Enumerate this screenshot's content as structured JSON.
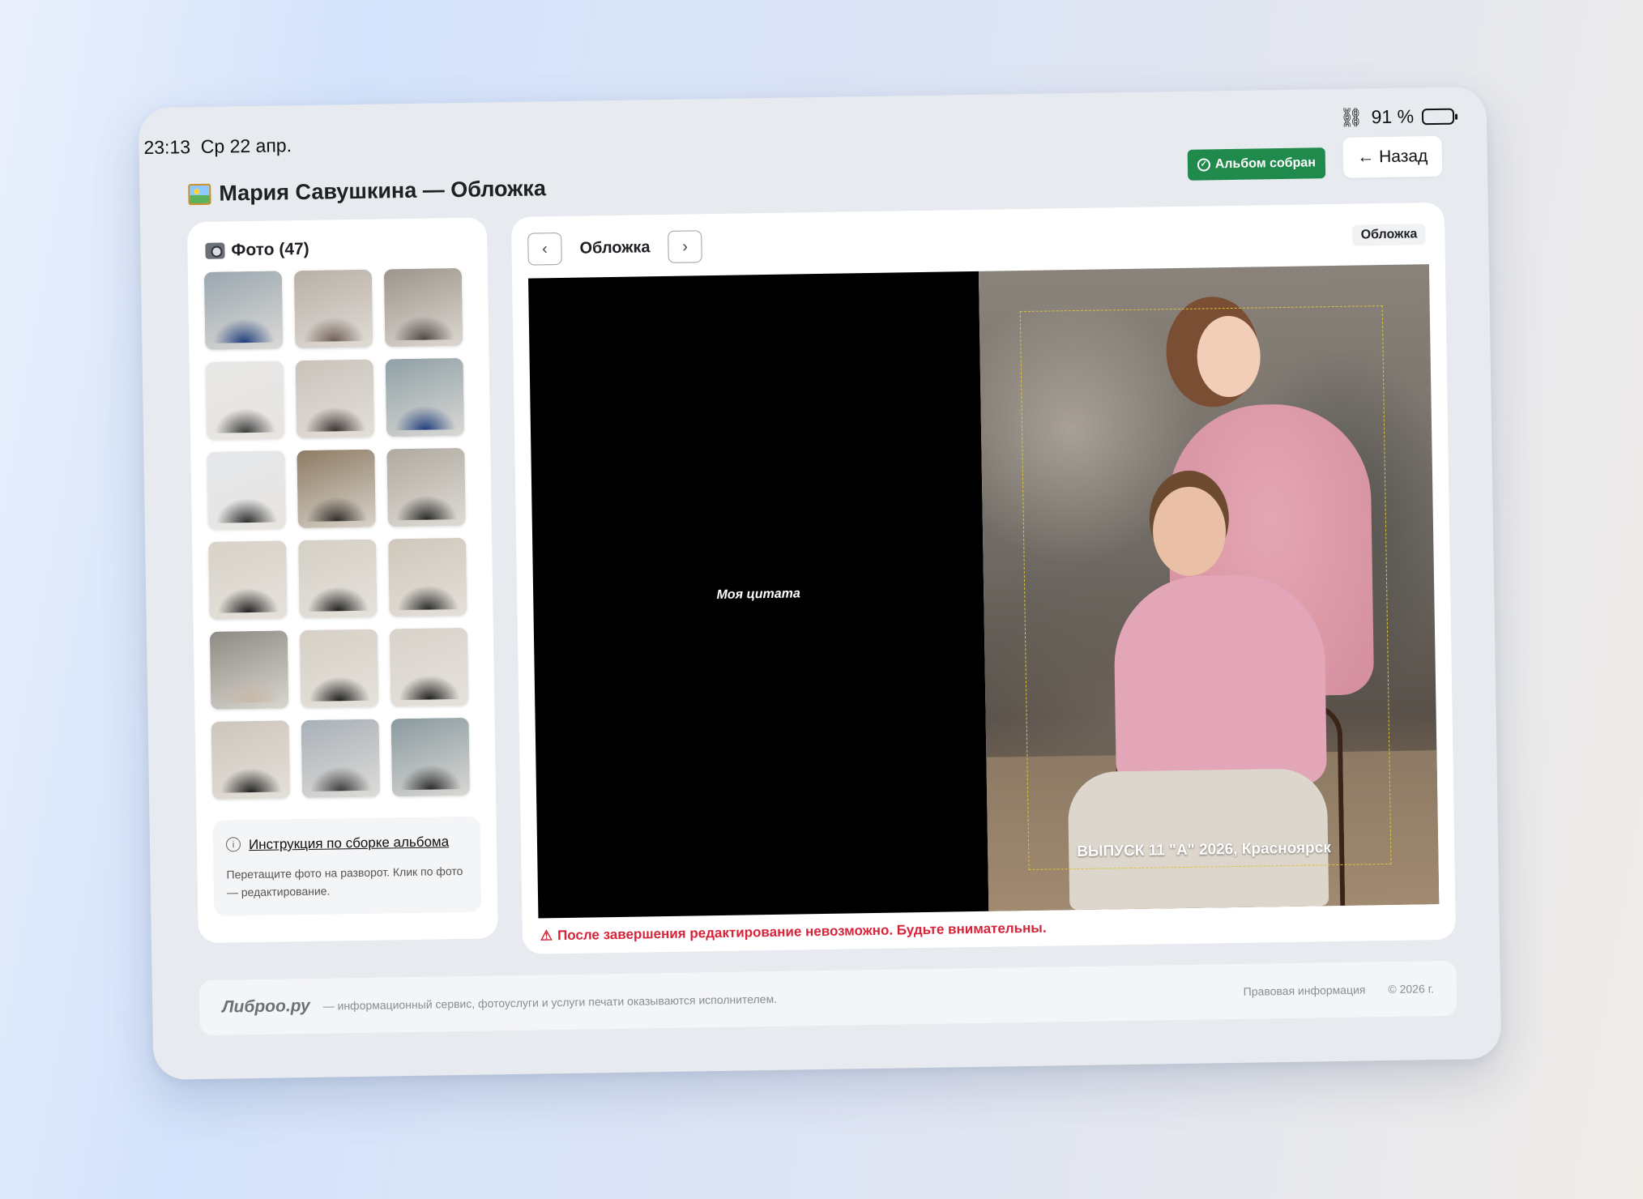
{
  "status": {
    "time": "23:13",
    "date": "Ср 22 апр.",
    "battery": "91 %",
    "battery_level": 0.91
  },
  "header": {
    "title": "Мария Савушкина — Обложка",
    "badge": "Альбом собран",
    "back": "← Назад"
  },
  "sidebar": {
    "title": "Фото (47)",
    "thumbs": [
      {
        "c1": "#9aa7b0",
        "c2": "#1f3d7a"
      },
      {
        "c1": "#b8b0a8",
        "c2": "#6e5e55"
      },
      {
        "c1": "#9d958c",
        "c2": "#4e4540"
      },
      {
        "c1": "#e8e8e8",
        "c2": "#3a3a3a"
      },
      {
        "c1": "#c9c3bb",
        "c2": "#3a3030"
      },
      {
        "c1": "#8fa0a6",
        "c2": "#1f3d7a"
      },
      {
        "c1": "#e6e8ec",
        "c2": "#2d2d2d"
      },
      {
        "c1": "#8d7b64",
        "c2": "#2d2a26"
      },
      {
        "c1": "#b0aaa0",
        "c2": "#252525"
      },
      {
        "c1": "#d8d2c8",
        "c2": "#1e1e1e"
      },
      {
        "c1": "#d5d0c6",
        "c2": "#1e1e1e"
      },
      {
        "c1": "#cfc7bb",
        "c2": "#2a2a2a"
      },
      {
        "c1": "#8e8a84",
        "c2": "#c8b8a6"
      },
      {
        "c1": "#d6d0c6",
        "c2": "#1d1d1d"
      },
      {
        "c1": "#d8d2ca",
        "c2": "#1e1e1e"
      },
      {
        "c1": "#cdc6bc",
        "c2": "#1f1f1f"
      },
      {
        "c1": "#a8b0b8",
        "c2": "#3a3a3a"
      },
      {
        "c1": "#8a9aa0",
        "c2": "#2a2a2a"
      }
    ],
    "info_link": "Инструкция по сборке альбома",
    "info_text": "Перетащите фото на разворот. Клик по фото — редактирование."
  },
  "main": {
    "nav_label": "Обложка",
    "tag": "Обложка",
    "quote": "Моя цитата",
    "caption": "ВЫПУСК 11 \"А\" 2026, Красноярск",
    "warning": "После завершения редактирование невозможно. Будьте внимательны."
  },
  "footer": {
    "logo": "Либроо.ру",
    "desc": "— информационный сервис, фотоуслуги и услуги печати оказываются исполнителем.",
    "legal": "Правовая информация",
    "copyright": "© 2026 г."
  }
}
